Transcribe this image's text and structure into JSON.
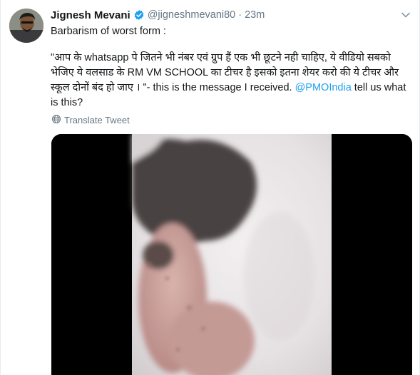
{
  "tweet": {
    "author_name": "Jignesh Mevani",
    "handle": "@jigneshmevani80",
    "separator": "·",
    "time": "23m",
    "line1": "Barbarism of worst form :",
    "quote_part1": "\"आप के whatsapp पे जितने भी नंबर एवं ग्रुप हैं एक भी छूटने नही चाहिए, ये वीडियो सबको भेजिए ये वलसाड के RM VM SCHOOL का टीचर है इसको इतना शेयर करो की ये टीचर और स्कूल दोनों बंद हो जाए । \"- this is the message I received. ",
    "mention": "@PMOIndia",
    "quote_part2": " tell us what is this?",
    "translate_label": "Translate Tweet"
  },
  "icons": {
    "verified": "verified-badge-icon",
    "menu": "chevron-down-icon",
    "translate": "globe-icon"
  },
  "colors": {
    "link": "#1da1f2",
    "secondary": "#657786",
    "verified": "#1da1f2",
    "media_bg": "#000000"
  }
}
